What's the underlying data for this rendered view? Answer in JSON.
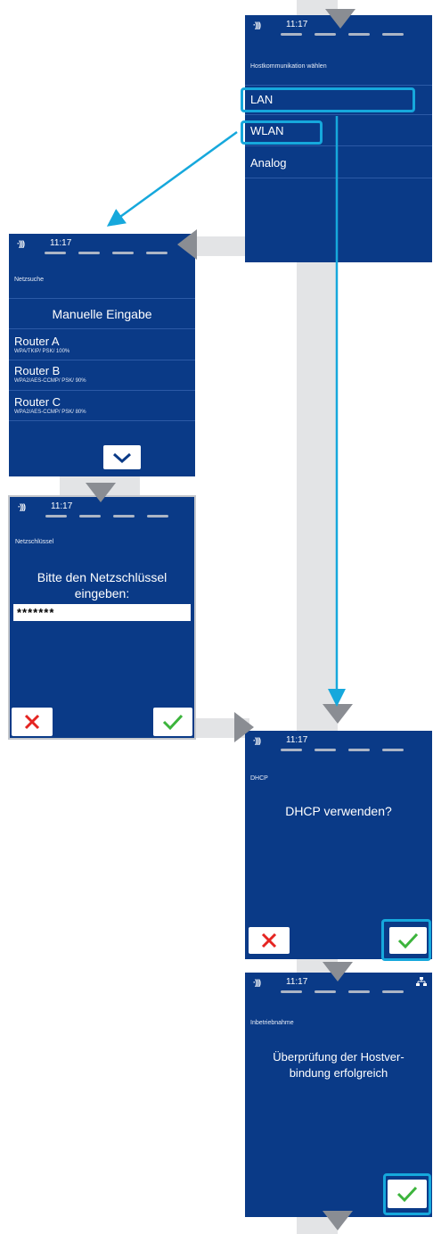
{
  "colors": {
    "screen_bg": "#0a3a87",
    "connector": "#e3e4e6",
    "arrow_gray": "#8a8d93",
    "highlight_cyan": "#16a8dc",
    "cancel_red": "#e52421",
    "confirm_green": "#3cb43c"
  },
  "common": {
    "nfc_symbol": "·)))",
    "time": "11:17"
  },
  "screen_host": {
    "subtitle": "Hostkommunikation wählen",
    "items": [
      "LAN",
      "WLAN",
      "Analog"
    ]
  },
  "screen_netzsuche": {
    "subtitle": "Netzsuche",
    "manual": "Manuelle Eingabe",
    "routers": [
      {
        "name": "Router A",
        "detail": "WPA/TKIP/ PSK/ 100%"
      },
      {
        "name": "Router B",
        "detail": "WPA2/AES-CCMP/ PSK/ 90%"
      },
      {
        "name": "Router C",
        "detail": "WPA2/AES-CCMP/ PSK/ 80%"
      }
    ],
    "scroll_icon": "chevron-down-icon"
  },
  "screen_key": {
    "subtitle": "Netzschlüssel",
    "prompt_line1": "Bitte den Netzschlüssel",
    "prompt_line2": "eingeben:",
    "value": "*******"
  },
  "screen_dhcp": {
    "subtitle": "DHCP",
    "question": "DHCP verwenden?"
  },
  "screen_commission": {
    "subtitle": "Inbetriebnahme",
    "message_line1": "Überprüfung der Hostver-",
    "message_line2": "bindung erfolgreich",
    "network_icon": "network-icon"
  }
}
